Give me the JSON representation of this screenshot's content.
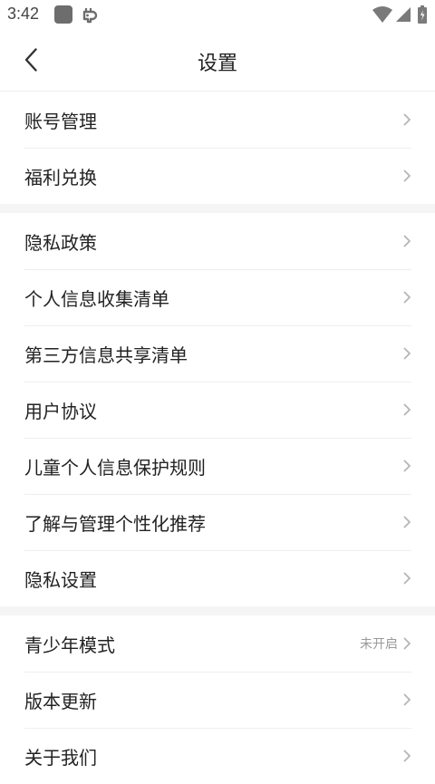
{
  "status_bar": {
    "time": "3:42",
    "icons": [
      "app-icon",
      "bug-icon",
      "wifi-icon",
      "signal-icon",
      "battery-icon"
    ]
  },
  "header": {
    "back_icon": "chevron-left-icon",
    "title": "设置"
  },
  "groups": [
    {
      "items": [
        {
          "label": "账号管理"
        },
        {
          "label": "福利兑换"
        }
      ]
    },
    {
      "items": [
        {
          "label": "隐私政策"
        },
        {
          "label": "个人信息收集清单"
        },
        {
          "label": "第三方信息共享清单"
        },
        {
          "label": "用户协议"
        },
        {
          "label": "儿童个人信息保护规则"
        },
        {
          "label": "了解与管理个性化推荐"
        },
        {
          "label": "隐私设置"
        }
      ]
    },
    {
      "items": [
        {
          "label": "青少年模式",
          "value": "未开启"
        },
        {
          "label": "版本更新"
        },
        {
          "label": "关于我们"
        }
      ]
    }
  ],
  "colors": {
    "text": "#222222",
    "secondary_text": "#999999",
    "chevron": "#b5b5b5",
    "divider": "#eeeeee",
    "group_gap": "#f5f5f5"
  }
}
